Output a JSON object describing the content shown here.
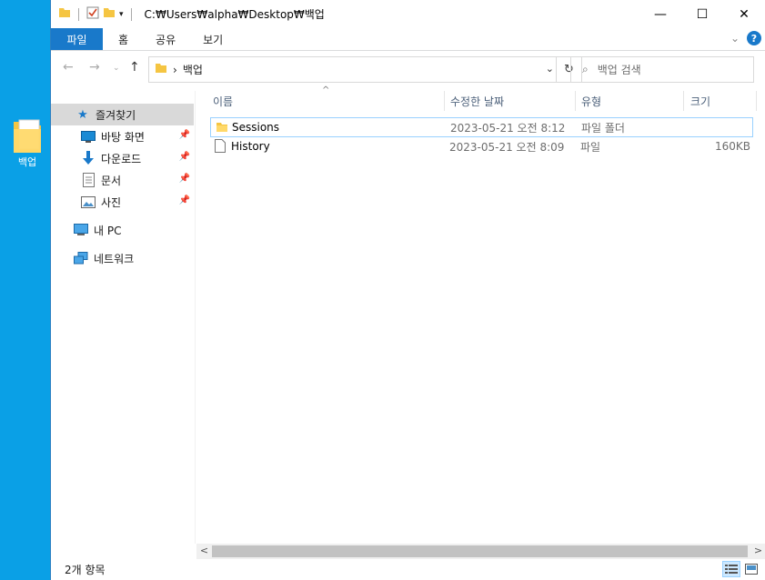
{
  "desktop": {
    "icon_label": "백업"
  },
  "title": {
    "path": "C:₩Users₩alpha₩Desktop₩백업"
  },
  "window_controls": {
    "minimize": "—",
    "maximize": "☐",
    "close": "✕"
  },
  "ribbon": {
    "tabs": [
      "파일",
      "홈",
      "공유",
      "보기"
    ],
    "expand": "⌄",
    "help": "?"
  },
  "address": {
    "crumb": "백업",
    "sep": "›",
    "dropdown": "⌄",
    "refresh": "↻"
  },
  "nav": {
    "back": "←",
    "forward": "→",
    "recent": "⌄",
    "up": "↑"
  },
  "search": {
    "placeholder": "백업 검색",
    "icon": "⌕"
  },
  "nav_pane": {
    "quick_access": "즐겨찾기",
    "items": [
      "바탕 화면",
      "다운로드",
      "문서",
      "사진"
    ],
    "this_pc": "내 PC",
    "network": "네트워크"
  },
  "columns": {
    "name": "이름",
    "modified": "수정한 날짜",
    "type": "유형",
    "size": "크기",
    "sort": "^"
  },
  "files": [
    {
      "name": "Sessions",
      "modified": "2023-05-21 오전 8:12",
      "type": "파일 폴더",
      "size": ""
    },
    {
      "name": "History",
      "modified": "2023-05-21 오전 8:09",
      "type": "파일",
      "size": "160KB"
    }
  ],
  "scroll": {
    "left": "<",
    "right": ">"
  },
  "status": {
    "count": "2개 항목"
  }
}
